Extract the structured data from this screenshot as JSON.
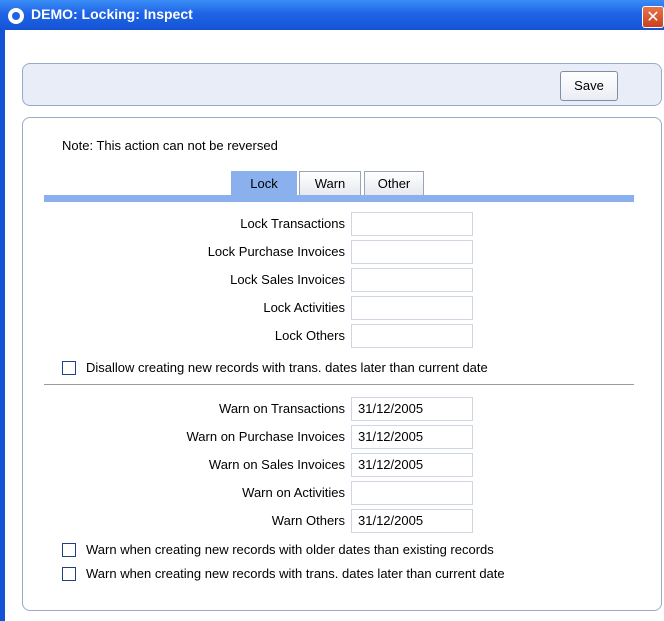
{
  "window": {
    "title": "DEMO: Locking: Inspect",
    "close_glyph": "✕"
  },
  "toolbar": {
    "save_label": "Save"
  },
  "note": "Note: This action can not be reversed",
  "tabs": [
    {
      "label": "Lock",
      "active": true
    },
    {
      "label": "Warn",
      "active": false
    },
    {
      "label": "Other",
      "active": false
    }
  ],
  "lock_fields": [
    {
      "label": "Lock Transactions",
      "value": ""
    },
    {
      "label": "Lock Purchase Invoices",
      "value": ""
    },
    {
      "label": "Lock Sales Invoices",
      "value": ""
    },
    {
      "label": "Lock Activities",
      "value": ""
    },
    {
      "label": "Lock Others",
      "value": ""
    }
  ],
  "lock_checkbox": {
    "label": "Disallow creating new records with trans. dates later than current date",
    "checked": false
  },
  "warn_fields": [
    {
      "label": "Warn on Transactions",
      "value": "31/12/2005"
    },
    {
      "label": "Warn on Purchase Invoices",
      "value": "31/12/2005"
    },
    {
      "label": "Warn on Sales Invoices",
      "value": "31/12/2005"
    },
    {
      "label": "Warn on Activities",
      "value": ""
    },
    {
      "label": "Warn Others",
      "value": "31/12/2005"
    }
  ],
  "warn_checkboxes": [
    {
      "label": "Warn when creating new records with older dates than existing records",
      "checked": false
    },
    {
      "label": "Warn when creating new records with trans. dates later than current date",
      "checked": false
    }
  ]
}
